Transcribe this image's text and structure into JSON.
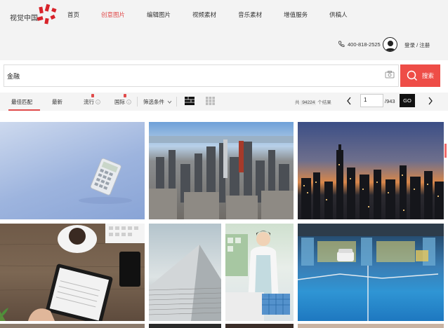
{
  "brand": {
    "name": "视觉中国"
  },
  "nav": {
    "items": [
      {
        "label": "首页"
      },
      {
        "label": "创意图片"
      },
      {
        "label": "编辑图片"
      },
      {
        "label": "视频素材"
      },
      {
        "label": "音乐素材"
      },
      {
        "label": "增值服务"
      },
      {
        "label": "供稿人"
      }
    ],
    "active_index": 1
  },
  "account": {
    "phone": "400-818-2525",
    "login_label": "登录 / 注册"
  },
  "search": {
    "query": "金融",
    "button_label": "搜索"
  },
  "filters": {
    "tabs": [
      {
        "label": "最佳匹配"
      },
      {
        "label": "最新"
      },
      {
        "label": "流行"
      },
      {
        "label": "国际"
      },
      {
        "label": "筛选条件"
      }
    ]
  },
  "results": {
    "total_prefix": "共",
    "total": "94224",
    "total_suffix": "个结果"
  },
  "pagination": {
    "current_page": "1",
    "total_pages": "/943",
    "go_label": "GO"
  },
  "colors": {
    "accent": "#ee4d47",
    "active_nav": "#e04b4b"
  },
  "images": [
    {
      "name": "calculator-photo"
    },
    {
      "name": "city-aerial-photo"
    },
    {
      "name": "city-night-photo"
    },
    {
      "name": "desk-tablet-photo"
    },
    {
      "name": "skyscraper-photo"
    },
    {
      "name": "shop-clerk-photo"
    },
    {
      "name": "parking-garage-photo"
    }
  ]
}
